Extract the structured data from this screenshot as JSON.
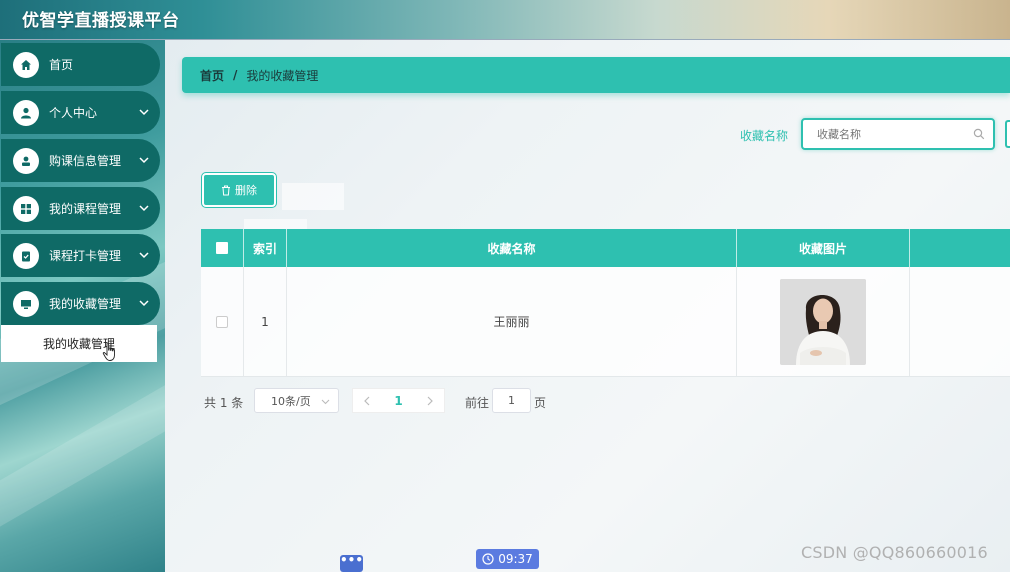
{
  "app": {
    "title": "优智学直播授课平台"
  },
  "sidebar": {
    "items": [
      {
        "label": "首页",
        "icon": "home-icon"
      },
      {
        "label": "个人中心",
        "icon": "user-icon"
      },
      {
        "label": "购课信息管理",
        "icon": "person-card-icon"
      },
      {
        "label": "我的课程管理",
        "icon": "grid-icon"
      },
      {
        "label": "课程打卡管理",
        "icon": "clipboard-check-icon"
      },
      {
        "label": "我的收藏管理",
        "icon": "monitor-icon"
      }
    ],
    "submenu": {
      "label": "我的收藏管理"
    }
  },
  "breadcrumb": {
    "home": "首页",
    "separator": "/",
    "current": "我的收藏管理"
  },
  "search": {
    "label": "收藏名称",
    "placeholder": "收藏名称"
  },
  "toolbar": {
    "delete_label": "删除"
  },
  "table": {
    "columns": [
      "索引",
      "收藏名称",
      "收藏图片"
    ],
    "rows": [
      {
        "index": "1",
        "name": "王丽丽",
        "image": "portrait-photo"
      }
    ]
  },
  "pagination": {
    "total": "共 1 条",
    "page_size": "10条/页",
    "current_page": "1",
    "goto_prefix": "前往",
    "goto_value": "1",
    "goto_suffix": "页"
  },
  "taskbar": {
    "chat": "•••",
    "clock": "09:37"
  },
  "watermark": "CSDN @QQ860660016",
  "colors": {
    "accent": "#2ec0b0",
    "sidebar_item": "#0f6a66"
  }
}
